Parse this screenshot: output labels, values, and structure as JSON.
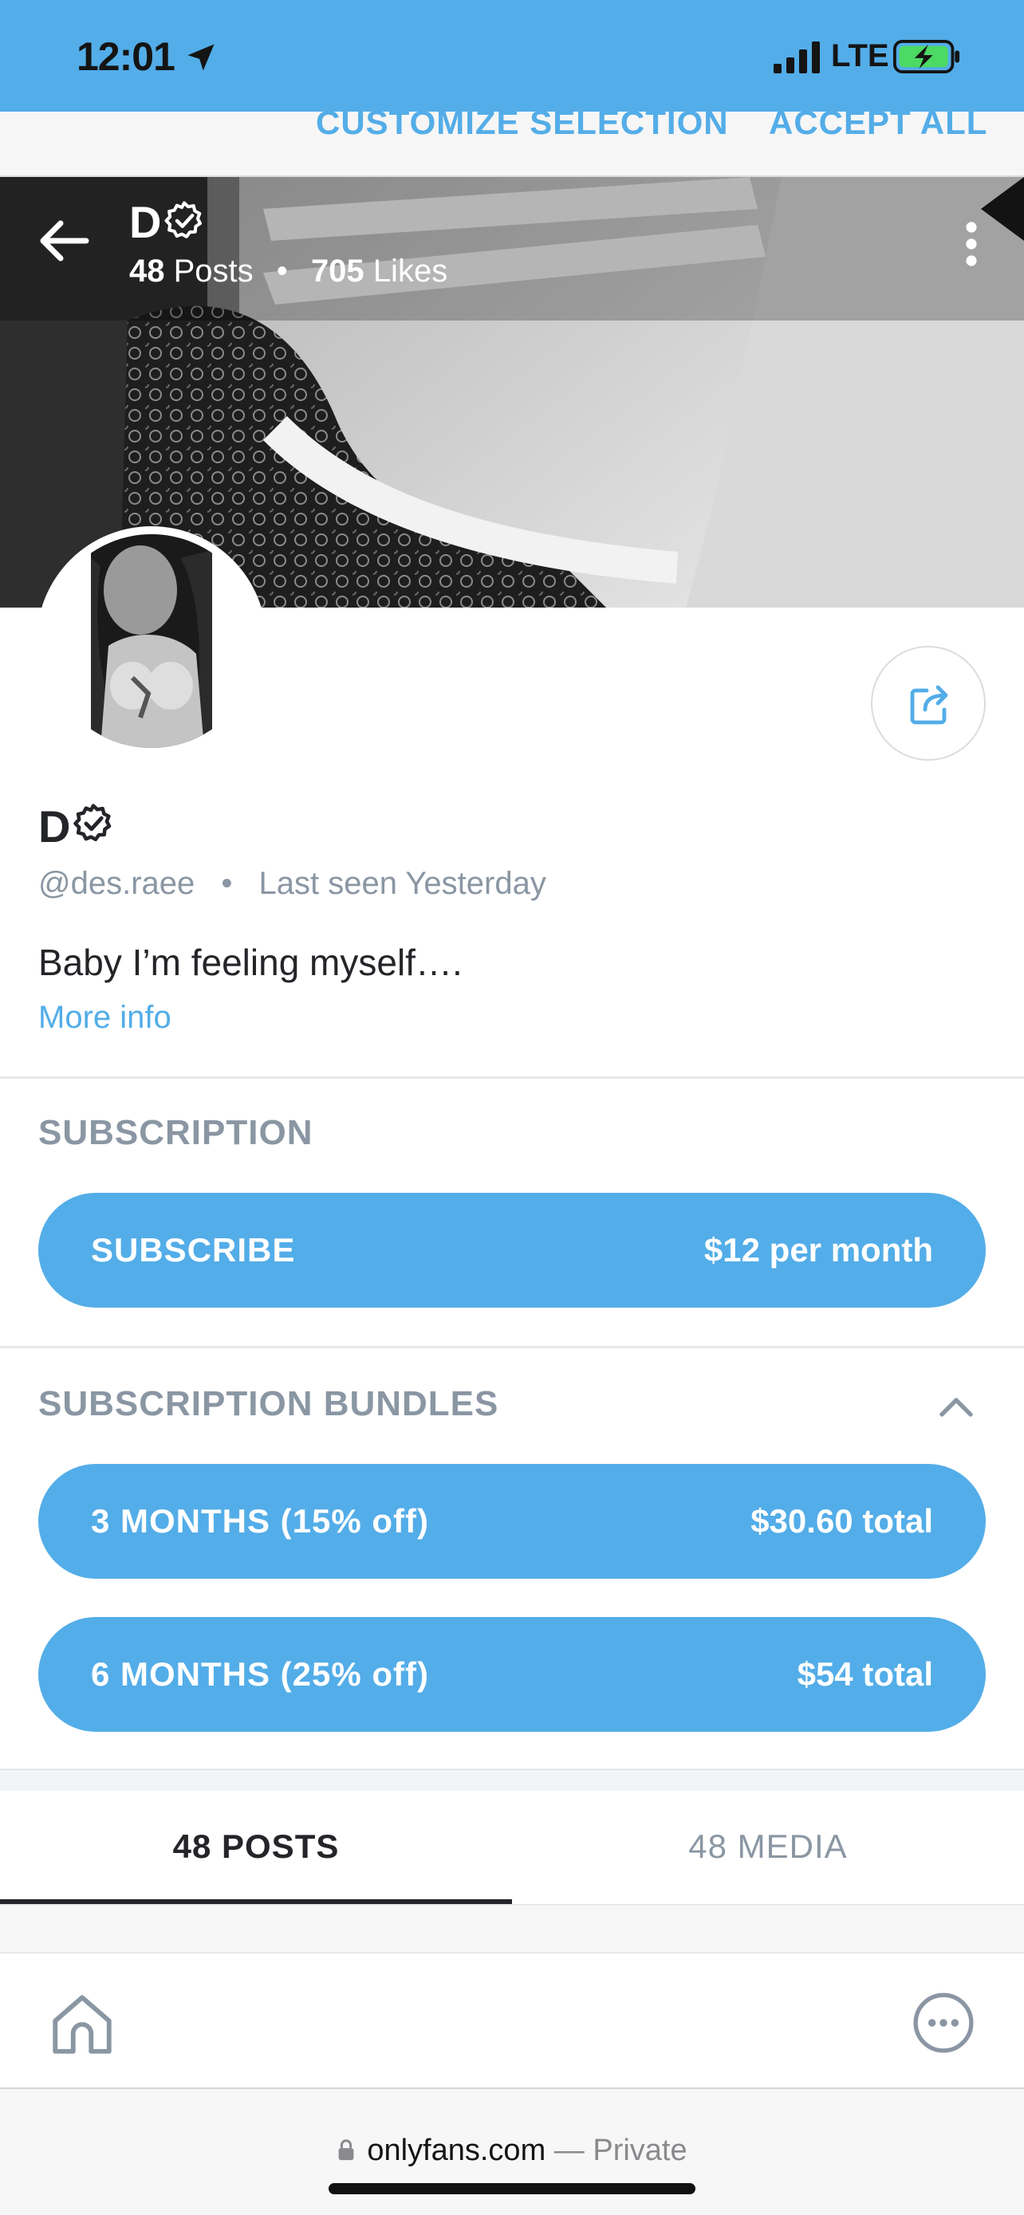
{
  "status_bar": {
    "time": "12:01",
    "network": "LTE"
  },
  "cookie_banner": {
    "customize_label": "CUSTOMIZE SELECTION",
    "accept_label": "ACCEPT ALL"
  },
  "header": {
    "name": "D",
    "posts_count": "48",
    "posts_label": "Posts",
    "likes_count": "705",
    "likes_label": "Likes"
  },
  "profile": {
    "name": "D",
    "handle": "@des.raee",
    "last_seen": "Last seen Yesterday",
    "bio": "Baby I’m feeling myself….",
    "more_info": "More info"
  },
  "subscription": {
    "title": "SUBSCRIPTION",
    "subscribe_label": "SUBSCRIBE",
    "price": "$12 per month"
  },
  "bundles": {
    "title": "SUBSCRIPTION BUNDLES",
    "items": [
      {
        "label": "3 MONTHS (15% off)",
        "price": "$30.60 total"
      },
      {
        "label": "6 MONTHS (25% off)",
        "price": "$54 total"
      }
    ]
  },
  "tabs": [
    {
      "label": "48 POSTS",
      "active": true
    },
    {
      "label": "48 MEDIA",
      "active": false
    }
  ],
  "browser": {
    "domain": "onlyfans.com",
    "separator": "—",
    "mode": "Private"
  },
  "colors": {
    "accent": "#53ade8",
    "text": "#242529",
    "muted": "#8a96a3"
  }
}
